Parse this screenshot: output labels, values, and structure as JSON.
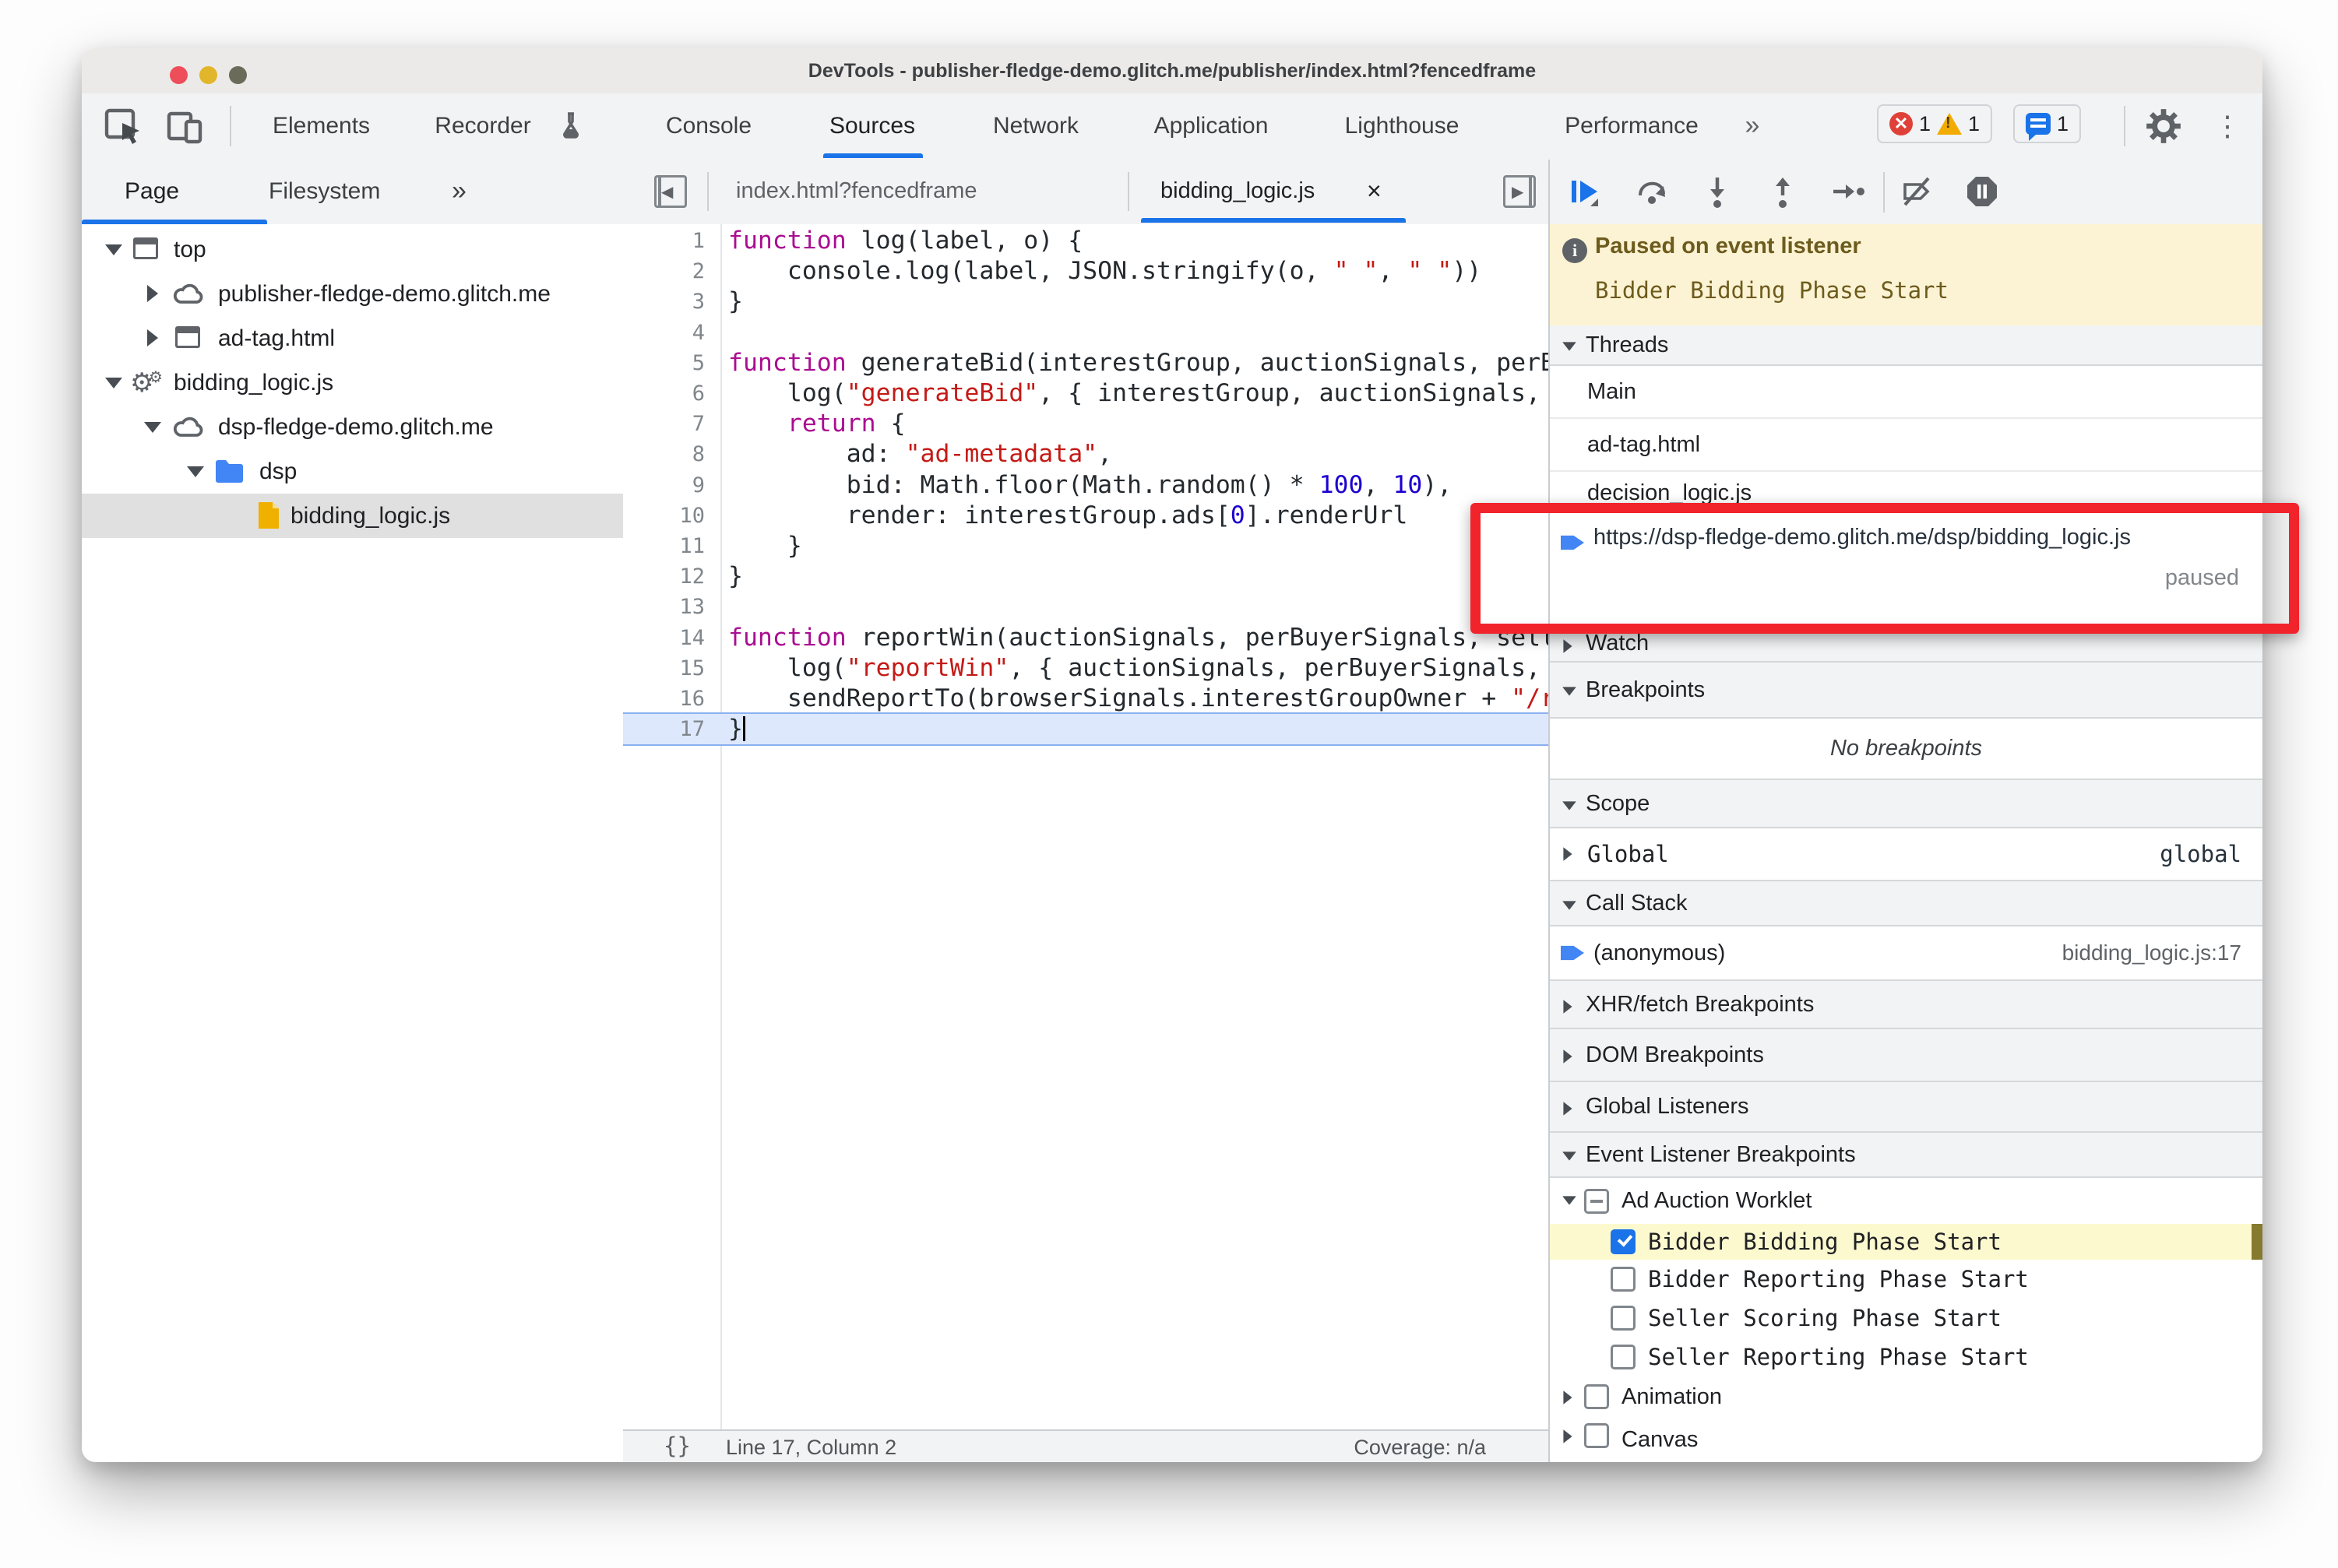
{
  "window": {
    "title": "DevTools - publisher-fledge-demo.glitch.me/publisher/index.html?fencedframe"
  },
  "toolbar": {
    "tabs": [
      {
        "label": "Elements"
      },
      {
        "label": "Recorder"
      },
      {
        "label": "Console"
      },
      {
        "label": "Sources",
        "active": true
      },
      {
        "label": "Network"
      },
      {
        "label": "Application"
      },
      {
        "label": "Lighthouse"
      },
      {
        "label": "Performance"
      }
    ],
    "more": "»",
    "overflow_menu": "⋮",
    "badges": {
      "errors": "1",
      "warnings": "1",
      "messages": "1"
    }
  },
  "sidebar": {
    "tabs": {
      "page": "Page",
      "filesystem": "Filesystem",
      "more": "»",
      "menu": "⋮"
    },
    "tree": [
      {
        "label": "top"
      },
      {
        "label": "publisher-fledge-demo.glitch.me"
      },
      {
        "label": "ad-tag.html"
      },
      {
        "label": "bidding_logic.js"
      },
      {
        "label": "dsp-fledge-demo.glitch.me"
      },
      {
        "label": "dsp"
      },
      {
        "label": "bidding_logic.js",
        "selected": true
      }
    ]
  },
  "editor": {
    "tabs": [
      {
        "label": "index.html?fencedframe"
      },
      {
        "label": "bidding_logic.js",
        "close": "×",
        "active": true
      }
    ],
    "active_line": 17,
    "status": {
      "braces": "{}",
      "position": "Line 17, Column 2",
      "coverage": "Coverage: n/a"
    },
    "code": [
      {
        "tokens": [
          [
            "k",
            "function"
          ],
          [
            "p",
            " log(label, o) {"
          ]
        ]
      },
      {
        "tokens": [
          [
            "p",
            "    console.log(label, JSON.stringify(o, "
          ],
          [
            "s",
            "\" \""
          ],
          [
            "p",
            ", "
          ],
          [
            "s",
            "\" \""
          ],
          [
            "p",
            "))"
          ]
        ]
      },
      {
        "tokens": [
          [
            "p",
            "}"
          ]
        ]
      },
      {
        "tokens": []
      },
      {
        "tokens": [
          [
            "k",
            "function"
          ],
          [
            "p",
            " generateBid(interestGroup, auctionSignals, perBuyerSignals, trustedBiddingSignals, browserSignals) {"
          ]
        ]
      },
      {
        "tokens": [
          [
            "p",
            "    log("
          ],
          [
            "s",
            "\"generateBid\""
          ],
          [
            "p",
            ", { interestGroup, auctionSignals, perBuyerSignals, trustedBiddingSignals, browserSignals });"
          ]
        ]
      },
      {
        "tokens": [
          [
            "p",
            "    "
          ],
          [
            "k",
            "return"
          ],
          [
            "p",
            " {"
          ]
        ]
      },
      {
        "tokens": [
          [
            "p",
            "        ad: "
          ],
          [
            "s",
            "\"ad-metadata\""
          ],
          [
            "p",
            ","
          ]
        ]
      },
      {
        "tokens": [
          [
            "p",
            "        bid: Math.floor(Math.random() * "
          ],
          [
            "n",
            "100"
          ],
          [
            "p",
            ", "
          ],
          [
            "n",
            "10"
          ],
          [
            "p",
            "),"
          ]
        ]
      },
      {
        "tokens": [
          [
            "p",
            "        render: interestGroup.ads["
          ],
          [
            "n",
            "0"
          ],
          [
            "p",
            "].renderUrl"
          ]
        ]
      },
      {
        "tokens": [
          [
            "p",
            "    }"
          ]
        ]
      },
      {
        "tokens": [
          [
            "p",
            "}"
          ]
        ]
      },
      {
        "tokens": []
      },
      {
        "tokens": [
          [
            "k",
            "function"
          ],
          [
            "p",
            " reportWin(auctionSignals, perBuyerSignals, sellerSignals, browserSignals) {"
          ]
        ]
      },
      {
        "tokens": [
          [
            "p",
            "    log("
          ],
          [
            "s",
            "\"reportWin\""
          ],
          [
            "p",
            ", { auctionSignals, perBuyerSignals, sellerSignals, browserSignals });"
          ]
        ]
      },
      {
        "tokens": [
          [
            "p",
            "    sendReportTo(browserSignals.interestGroupOwner + "
          ],
          [
            "s",
            "\"/reporting?report=win\""
          ],
          [
            "p",
            ");"
          ]
        ]
      },
      {
        "tokens": [
          [
            "p",
            "}"
          ]
        ]
      }
    ]
  },
  "debugger": {
    "banner": {
      "title": "Paused on event listener",
      "detail": "Bidder Bidding Phase Start"
    },
    "threads": {
      "header": "Threads",
      "items": [
        {
          "label": "Main"
        },
        {
          "label": "ad-tag.html"
        },
        {
          "label": "decision_logic.js"
        }
      ],
      "active": {
        "url": "https://dsp-fledge-demo.glitch.me/dsp/bidding_logic.js",
        "status": "paused"
      }
    },
    "watch": {
      "header": "Watch"
    },
    "breakpoints": {
      "header": "Breakpoints",
      "empty": "No breakpoints"
    },
    "scope": {
      "header": "Scope",
      "rows": [
        {
          "name": "Global",
          "value": "global"
        }
      ]
    },
    "call_stack": {
      "header": "Call Stack",
      "rows": [
        {
          "name": "(anonymous)",
          "location": "bidding_logic.js:17"
        }
      ]
    },
    "xhr": {
      "header": "XHR/fetch Breakpoints"
    },
    "dom": {
      "header": "DOM Breakpoints"
    },
    "global_listeners": {
      "header": "Global Listeners"
    },
    "event_listener_breakpoints": {
      "header": "Event Listener Breakpoints",
      "group": {
        "label": "Ad Auction Worklet",
        "state": "indeterminate"
      },
      "items": [
        {
          "label": "Bidder Bidding Phase Start",
          "checked": true,
          "highlighted": true
        },
        {
          "label": "Bidder Reporting Phase Start",
          "checked": false
        },
        {
          "label": "Seller Scoring Phase Start",
          "checked": false
        },
        {
          "label": "Seller Reporting Phase Start",
          "checked": false
        }
      ],
      "siblings": [
        {
          "label": "Animation",
          "checked": false
        },
        {
          "label": "Canvas",
          "checked": false
        }
      ]
    }
  },
  "colors": {
    "accent": "#1a73e8",
    "annotation": "#f1232b",
    "paused_banner": "#fbf3d3",
    "highlight_row": "#fdf9cf"
  }
}
